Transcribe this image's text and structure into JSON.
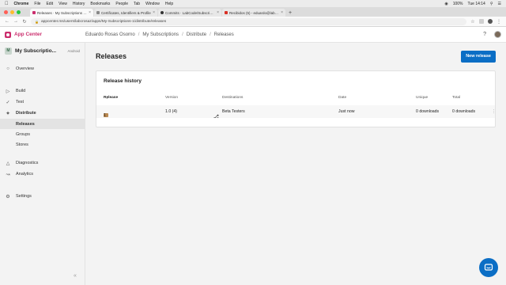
{
  "menubar": {
    "app": "Chrome",
    "items": [
      "File",
      "Edit",
      "View",
      "History",
      "Bookmarks",
      "People",
      "Tab",
      "Window",
      "Help"
    ],
    "battery": "100%",
    "clock": "Tue 14:14"
  },
  "tabs": [
    {
      "label": "Releases · My Subscriptions · Ap",
      "color": "#cb2e6d",
      "active": true
    },
    {
      "label": "Certificates, Identifiers & Profile",
      "color": "#888888",
      "active": false
    },
    {
      "label": "Commits · LabCode/Subscriptio",
      "color": "#333333",
      "active": false
    },
    {
      "label": "Recibidos (5) - eduardo@lab.co",
      "color": "#d93025",
      "active": false
    }
  ],
  "address": {
    "url": "appcenter.ms/users/labcrosaz/apps/My-Subscriptions-1/distribute/releases"
  },
  "header": {
    "brand": "App Center",
    "breadcrumbs": [
      "Eduardo Rosas Osorno",
      "My Subscriptions",
      "Distribute",
      "Releases"
    ],
    "help_icon": "?"
  },
  "sidebar": {
    "app_initial": "M",
    "app_name": "My Subscriptio...",
    "platform": "Android",
    "items": [
      {
        "label": "Overview",
        "icon": "circle-icon"
      },
      {
        "label": "Build",
        "icon": "play-icon"
      },
      {
        "label": "Test",
        "icon": "check-icon"
      },
      {
        "label": "Distribute",
        "icon": "distribute-icon"
      }
    ],
    "sub_items": [
      "Releases",
      "Groups",
      "Stores"
    ],
    "items2": [
      {
        "label": "Diagnostics",
        "icon": "warning-icon"
      },
      {
        "label": "Analytics",
        "icon": "chart-icon"
      }
    ],
    "settings": "Settings",
    "collapse": "«"
  },
  "main": {
    "title": "Releases",
    "new_release": "New release",
    "card_title": "Release history",
    "columns": {
      "release": "Release",
      "version": "Version",
      "destinations": "Destinations",
      "date": "Date",
      "unique": "Unique",
      "total": "Total"
    },
    "rows": [
      {
        "release": "1",
        "version": "1.0 (4)",
        "destinations": "Beta Testers",
        "date": "Just now",
        "unique": "0 downloads",
        "total": "0 downloads"
      }
    ]
  }
}
